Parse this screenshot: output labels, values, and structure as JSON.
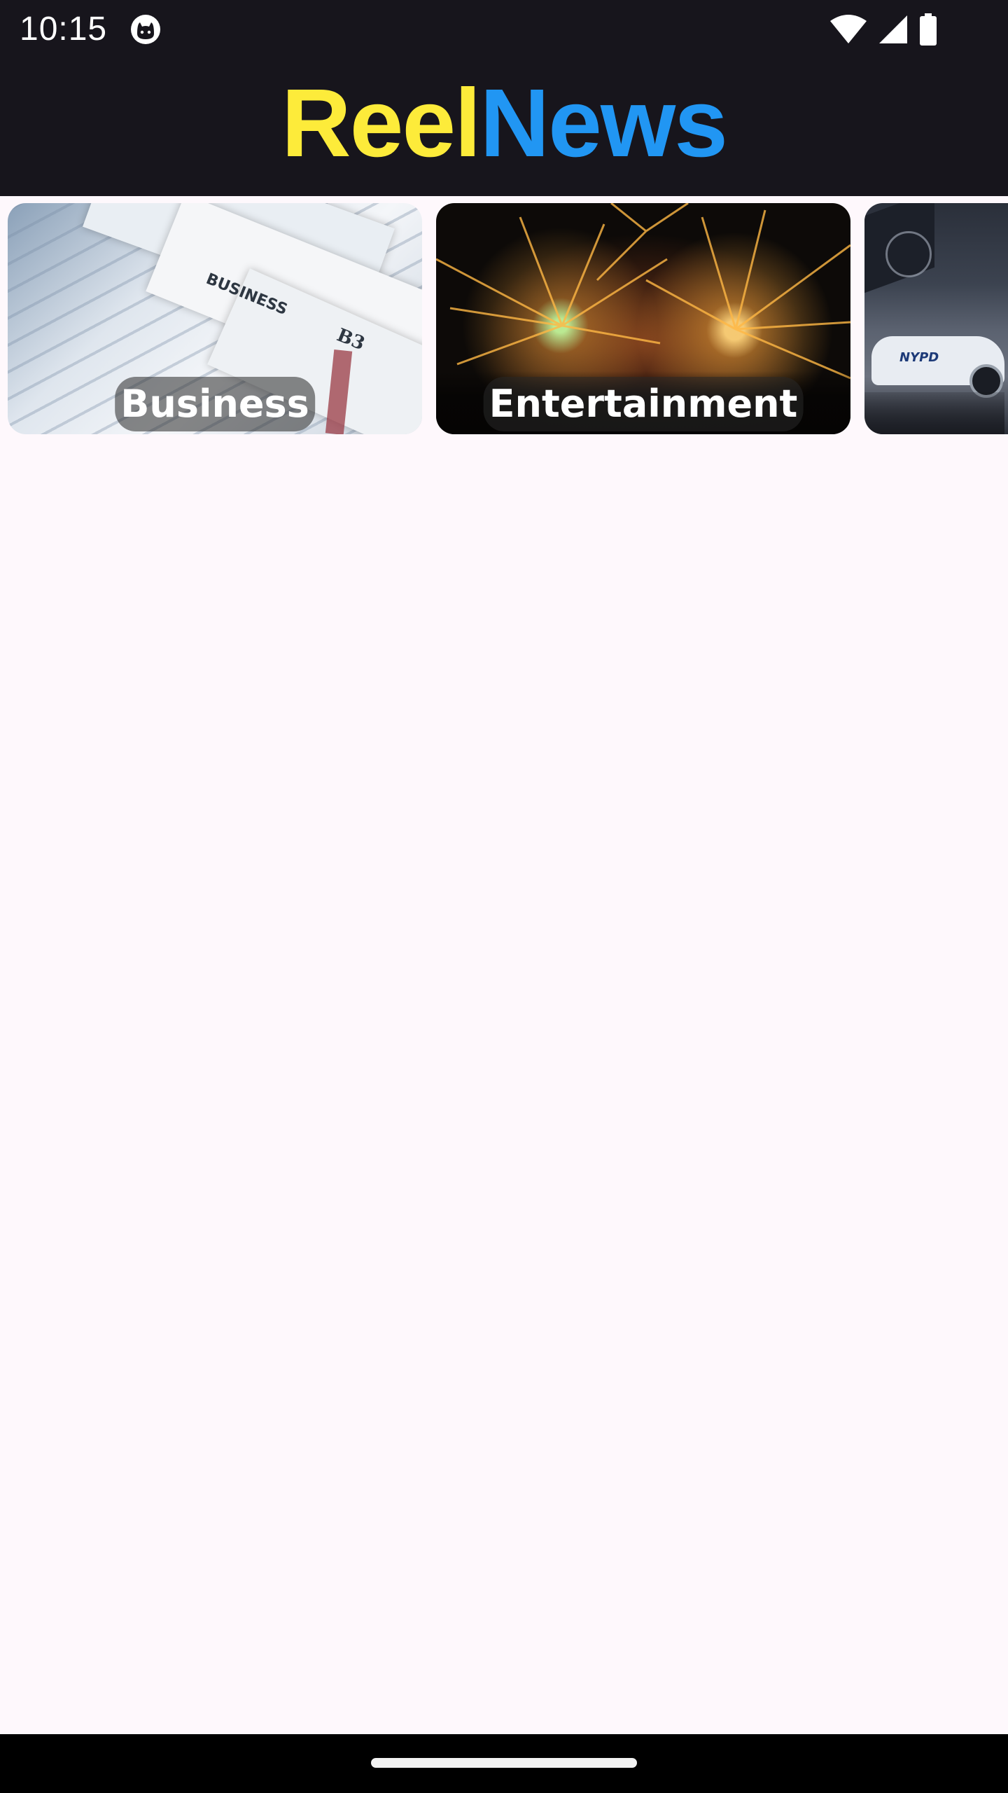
{
  "status_bar": {
    "time": "10:15",
    "icons": [
      "cat-notification-icon",
      "wifi-icon",
      "cellular-signal-icon",
      "battery-icon"
    ]
  },
  "app": {
    "logo_part1": "Reel",
    "logo_part2": "News",
    "colors": {
      "header_bg": "#17151c",
      "logo_reel": "#fdeb3a",
      "logo_news": "#2196f3",
      "page_bg": "#fef8fc"
    }
  },
  "categories": [
    {
      "label": "Business"
    },
    {
      "label": "Entertainment"
    },
    {
      "label": ""
    }
  ]
}
